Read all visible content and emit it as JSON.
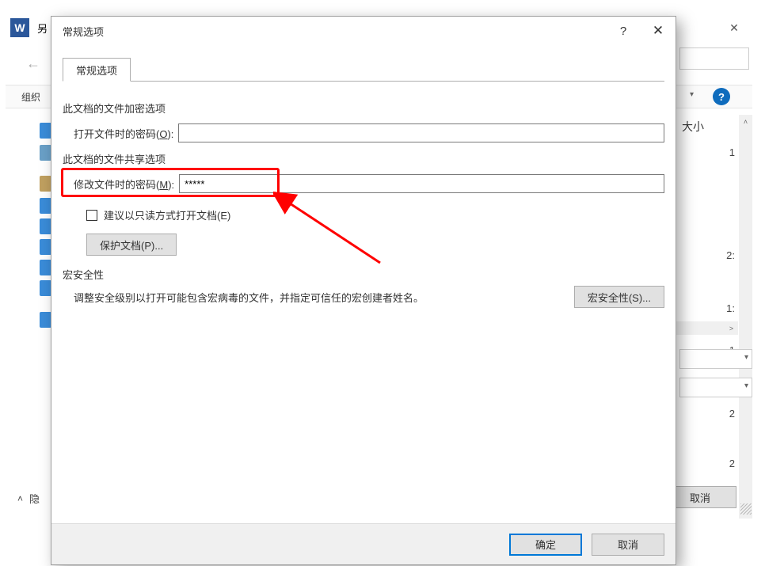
{
  "outer": {
    "title_fragment": "另",
    "organize_label": "组织",
    "col_size": "大小",
    "hide_folders": "隐",
    "cancel": "取消",
    "rows": [
      "1",
      "2:",
      "1:",
      "1",
      "2",
      "2"
    ]
  },
  "dialog": {
    "title": "常规选项",
    "tab": "常规选项",
    "encrypt_section": "此文档的文件加密选项",
    "open_password_label_pre": "打开文件时的密码(",
    "open_password_label_ul": "O",
    "open_password_label_post": "):",
    "open_password_value": "",
    "share_section": "此文档的文件共享选项",
    "modify_password_label_pre": "修改文件时的密码(",
    "modify_password_label_ul": "M",
    "modify_password_label_post": "):",
    "modify_password_value": "*****",
    "readonly_label_pre": "建议以只读方式打开文档(",
    "readonly_label_ul": "E",
    "readonly_label_post": ")",
    "protect_btn_pre": "保护文档(",
    "protect_btn_ul": "P",
    "protect_btn_post": ")...",
    "macro_section": "宏安全性",
    "macro_text": "调整安全级别以打开可能包含宏病毒的文件，并指定可信任的宏创建者姓名。",
    "macro_btn_pre": "宏安全性(",
    "macro_btn_ul": "S",
    "macro_btn_post": ")...",
    "ok": "确定",
    "cancel": "取消"
  }
}
